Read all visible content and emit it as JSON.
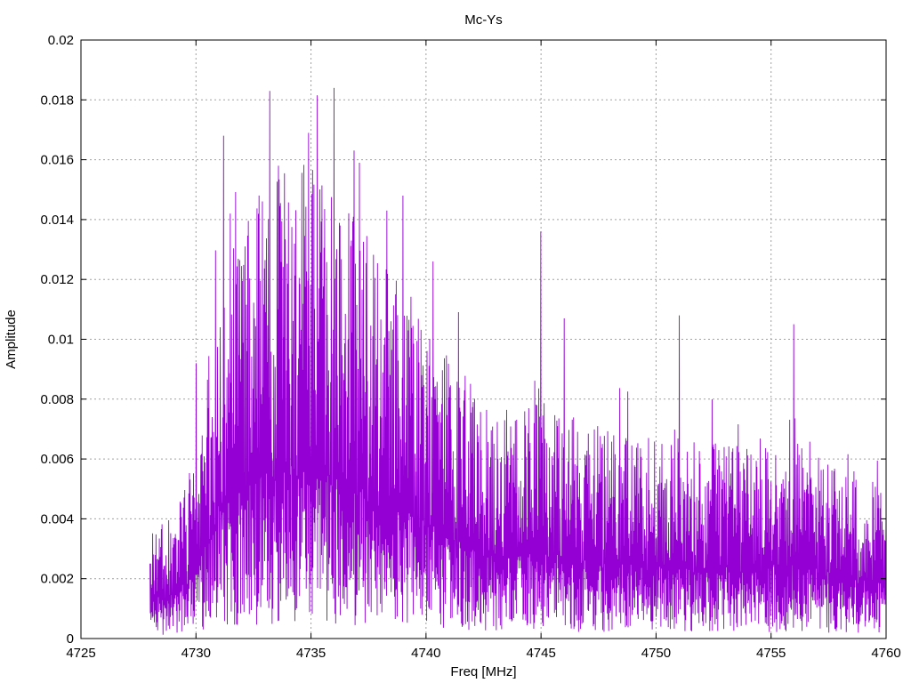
{
  "chart_data": {
    "type": "line",
    "title": "Mc-Ys",
    "xlabel": "Freq [MHz]",
    "ylabel": "Amplitude",
    "xlim": [
      4725,
      4760
    ],
    "ylim": [
      0,
      0.02
    ],
    "x_ticks": [
      "4725",
      "4730",
      "4735",
      "4740",
      "4745",
      "4750",
      "4755",
      "4760"
    ],
    "y_ticks": [
      "0",
      "0.002",
      "0.004",
      "0.006",
      "0.008",
      "0.01",
      "0.012",
      "0.014",
      "0.016",
      "0.018",
      "0.02"
    ],
    "grid": true,
    "series": [
      {
        "color": "#9400d3",
        "x_start": 4728.0,
        "x_end": 4760.0,
        "envelope_x": [
          4728.0,
          4729.0,
          4729.8,
          4730.5,
          4731.0,
          4731.5,
          4732.0,
          4733.0,
          4734.0,
          4735.0,
          4736.0,
          4737.0,
          4738.0,
          4739.0,
          4740.0,
          4741.0,
          4742.0,
          4743.0,
          4744.0,
          4745.0,
          4746.0,
          4747.0,
          4748.0,
          4750.0,
          4752.0,
          4754.0,
          4756.0,
          4758.0,
          4760.0
        ],
        "envelope_y": [
          0.0022,
          0.0025,
          0.0035,
          0.0055,
          0.0075,
          0.0078,
          0.0082,
          0.0095,
          0.0098,
          0.0095,
          0.009,
          0.0085,
          0.0078,
          0.0072,
          0.0065,
          0.0058,
          0.0052,
          0.0048,
          0.0046,
          0.0048,
          0.0046,
          0.0044,
          0.0042,
          0.0041,
          0.004,
          0.004,
          0.0042,
          0.0036,
          0.003
        ],
        "peaks": [
          [
            4731.2,
            0.0168
          ],
          [
            4731.5,
            0.0142
          ],
          [
            4733.2,
            0.0183
          ],
          [
            4733.6,
            0.0158
          ],
          [
            4734.9,
            0.0169
          ],
          [
            4736.0,
            0.0184
          ],
          [
            4737.1,
            0.0159
          ],
          [
            4738.3,
            0.0143
          ],
          [
            4739.0,
            0.0148
          ],
          [
            4740.3,
            0.0126
          ],
          [
            4745.0,
            0.0136
          ],
          [
            4746.0,
            0.0107
          ],
          [
            4751.0,
            0.0108
          ],
          [
            4756.0,
            0.0105
          ],
          [
            4730.0,
            0.0092
          ]
        ]
      }
    ]
  }
}
